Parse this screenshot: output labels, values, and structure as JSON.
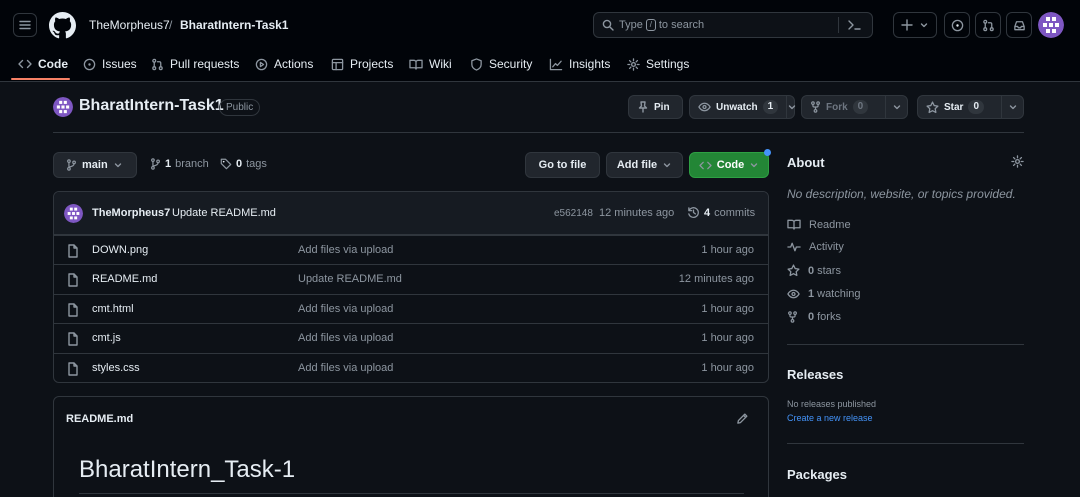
{
  "header": {
    "owner": "TheMorpheus7",
    "separator": "/",
    "repo": "BharatIntern-Task1",
    "search_placeholder_pre": "Type",
    "search_key": "/",
    "search_placeholder_post": "to search"
  },
  "tabs": [
    {
      "label": "Code",
      "icon": "code-icon",
      "active": true
    },
    {
      "label": "Issues",
      "icon": "issue-icon"
    },
    {
      "label": "Pull requests",
      "icon": "pull-request-icon"
    },
    {
      "label": "Actions",
      "icon": "play-icon"
    },
    {
      "label": "Projects",
      "icon": "table-icon"
    },
    {
      "label": "Wiki",
      "icon": "book-icon"
    },
    {
      "label": "Security",
      "icon": "shield-icon"
    },
    {
      "label": "Insights",
      "icon": "graph-icon"
    },
    {
      "label": "Settings",
      "icon": "gear-icon"
    }
  ],
  "repo": {
    "name": "BharatIntern-Task1",
    "visibility": "Public",
    "pin_label": "Pin",
    "watch_label": "Unwatch",
    "watch_count": "1",
    "fork_label": "Fork",
    "fork_count": "0",
    "star_label": "Star",
    "star_count": "0"
  },
  "branch": {
    "current": "main",
    "branches_count": "1",
    "branches_label": "branch",
    "tags_count": "0",
    "tags_label": "tags",
    "goto_file": "Go to file",
    "add_file": "Add file",
    "code": "Code"
  },
  "commit": {
    "author": "TheMorpheus7",
    "message": "Update README.md",
    "hash": "e562148",
    "time": "12 minutes ago",
    "count": "4",
    "count_label": "commits"
  },
  "files": [
    {
      "name": "DOWN.png",
      "message": "Add files via upload",
      "time": "1 hour ago"
    },
    {
      "name": "README.md",
      "message": "Update README.md",
      "time": "12 minutes ago"
    },
    {
      "name": "cmt.html",
      "message": "Add files via upload",
      "time": "1 hour ago"
    },
    {
      "name": "cmt.js",
      "message": "Add files via upload",
      "time": "1 hour ago"
    },
    {
      "name": "styles.css",
      "message": "Add files via upload",
      "time": "1 hour ago"
    }
  ],
  "readme": {
    "filename": "README.md",
    "title": "BharatIntern_Task-1"
  },
  "sidebar": {
    "about_title": "About",
    "about_desc": "No description, website, or topics provided.",
    "readme_label": "Readme",
    "activity_label": "Activity",
    "stars_count": "0",
    "stars_label": "stars",
    "watching_count": "1",
    "watching_label": "watching",
    "forks_count": "0",
    "forks_label": "forks",
    "releases_title": "Releases",
    "releases_note": "No releases published",
    "releases_link": "Create a new release",
    "packages_title": "Packages"
  },
  "colors": {
    "background": "#0d1117",
    "header": "#010409",
    "accent_green": "#238636",
    "link_blue": "#4493f8",
    "tab_underline": "#f78166"
  }
}
